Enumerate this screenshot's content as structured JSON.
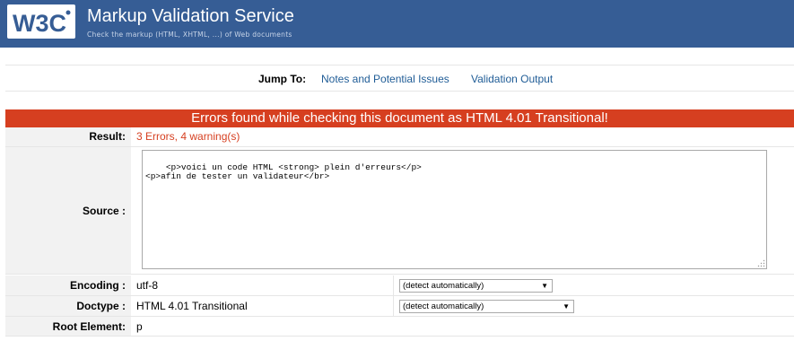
{
  "header": {
    "logo_text": "W3C",
    "title": "Markup Validation Service",
    "subtitle": "Check the markup (HTML, XHTML, ...) of Web documents"
  },
  "jump": {
    "label": "Jump To:",
    "links": [
      "Notes and Potential Issues",
      "Validation Output"
    ]
  },
  "result_banner": "Errors found while checking this document as HTML 4.01 Transitional!",
  "rows": {
    "result": {
      "label": "Result:",
      "value": "3 Errors, 4 warning(s)"
    },
    "source": {
      "label": "Source :",
      "value": "<p>voici un code HTML <strong> plein d'erreurs</p>\n<p>afin de tester un validateur</br>"
    },
    "encoding": {
      "label": "Encoding :",
      "value": "utf-8",
      "select": "(detect automatically)"
    },
    "doctype": {
      "label": "Doctype :",
      "value": "HTML 4.01 Transitional",
      "select": "(detect automatically)"
    },
    "root": {
      "label": "Root Element:",
      "value": "p"
    }
  },
  "colors": {
    "banner": "#365d95",
    "error": "#d63f20",
    "link": "#1f5c96"
  }
}
